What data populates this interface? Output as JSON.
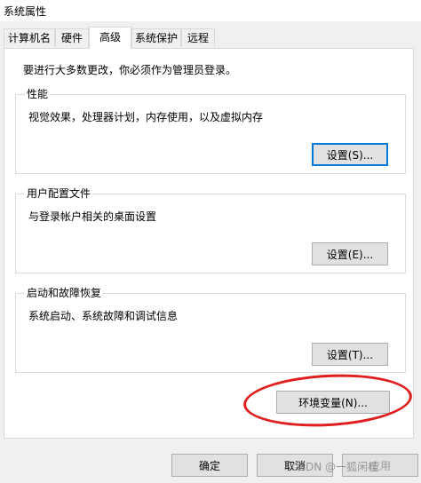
{
  "window": {
    "title": "系统属性"
  },
  "tabs": [
    {
      "label": "计算机名"
    },
    {
      "label": "硬件"
    },
    {
      "label": "高级"
    },
    {
      "label": "系统保护"
    },
    {
      "label": "远程"
    }
  ],
  "admin_note": "要进行大多数更改，你必须作为管理员登录。",
  "performance": {
    "title": "性能",
    "description": "视觉效果，处理器计划，内存使用，以及虚拟内存",
    "button": "设置(S)..."
  },
  "user_profiles": {
    "title": "用户配置文件",
    "description": "与登录帐户相关的桌面设置",
    "button": "设置(E)..."
  },
  "startup_recovery": {
    "title": "启动和故障恢复",
    "description": "系统启动、系统故障和调试信息",
    "button": "设置(T)..."
  },
  "env_button": "环境变量(N)...",
  "footer": {
    "ok": "确定",
    "cancel": "取消",
    "apply": "应用"
  },
  "watermark": "CSDN @一狐闲桂"
}
